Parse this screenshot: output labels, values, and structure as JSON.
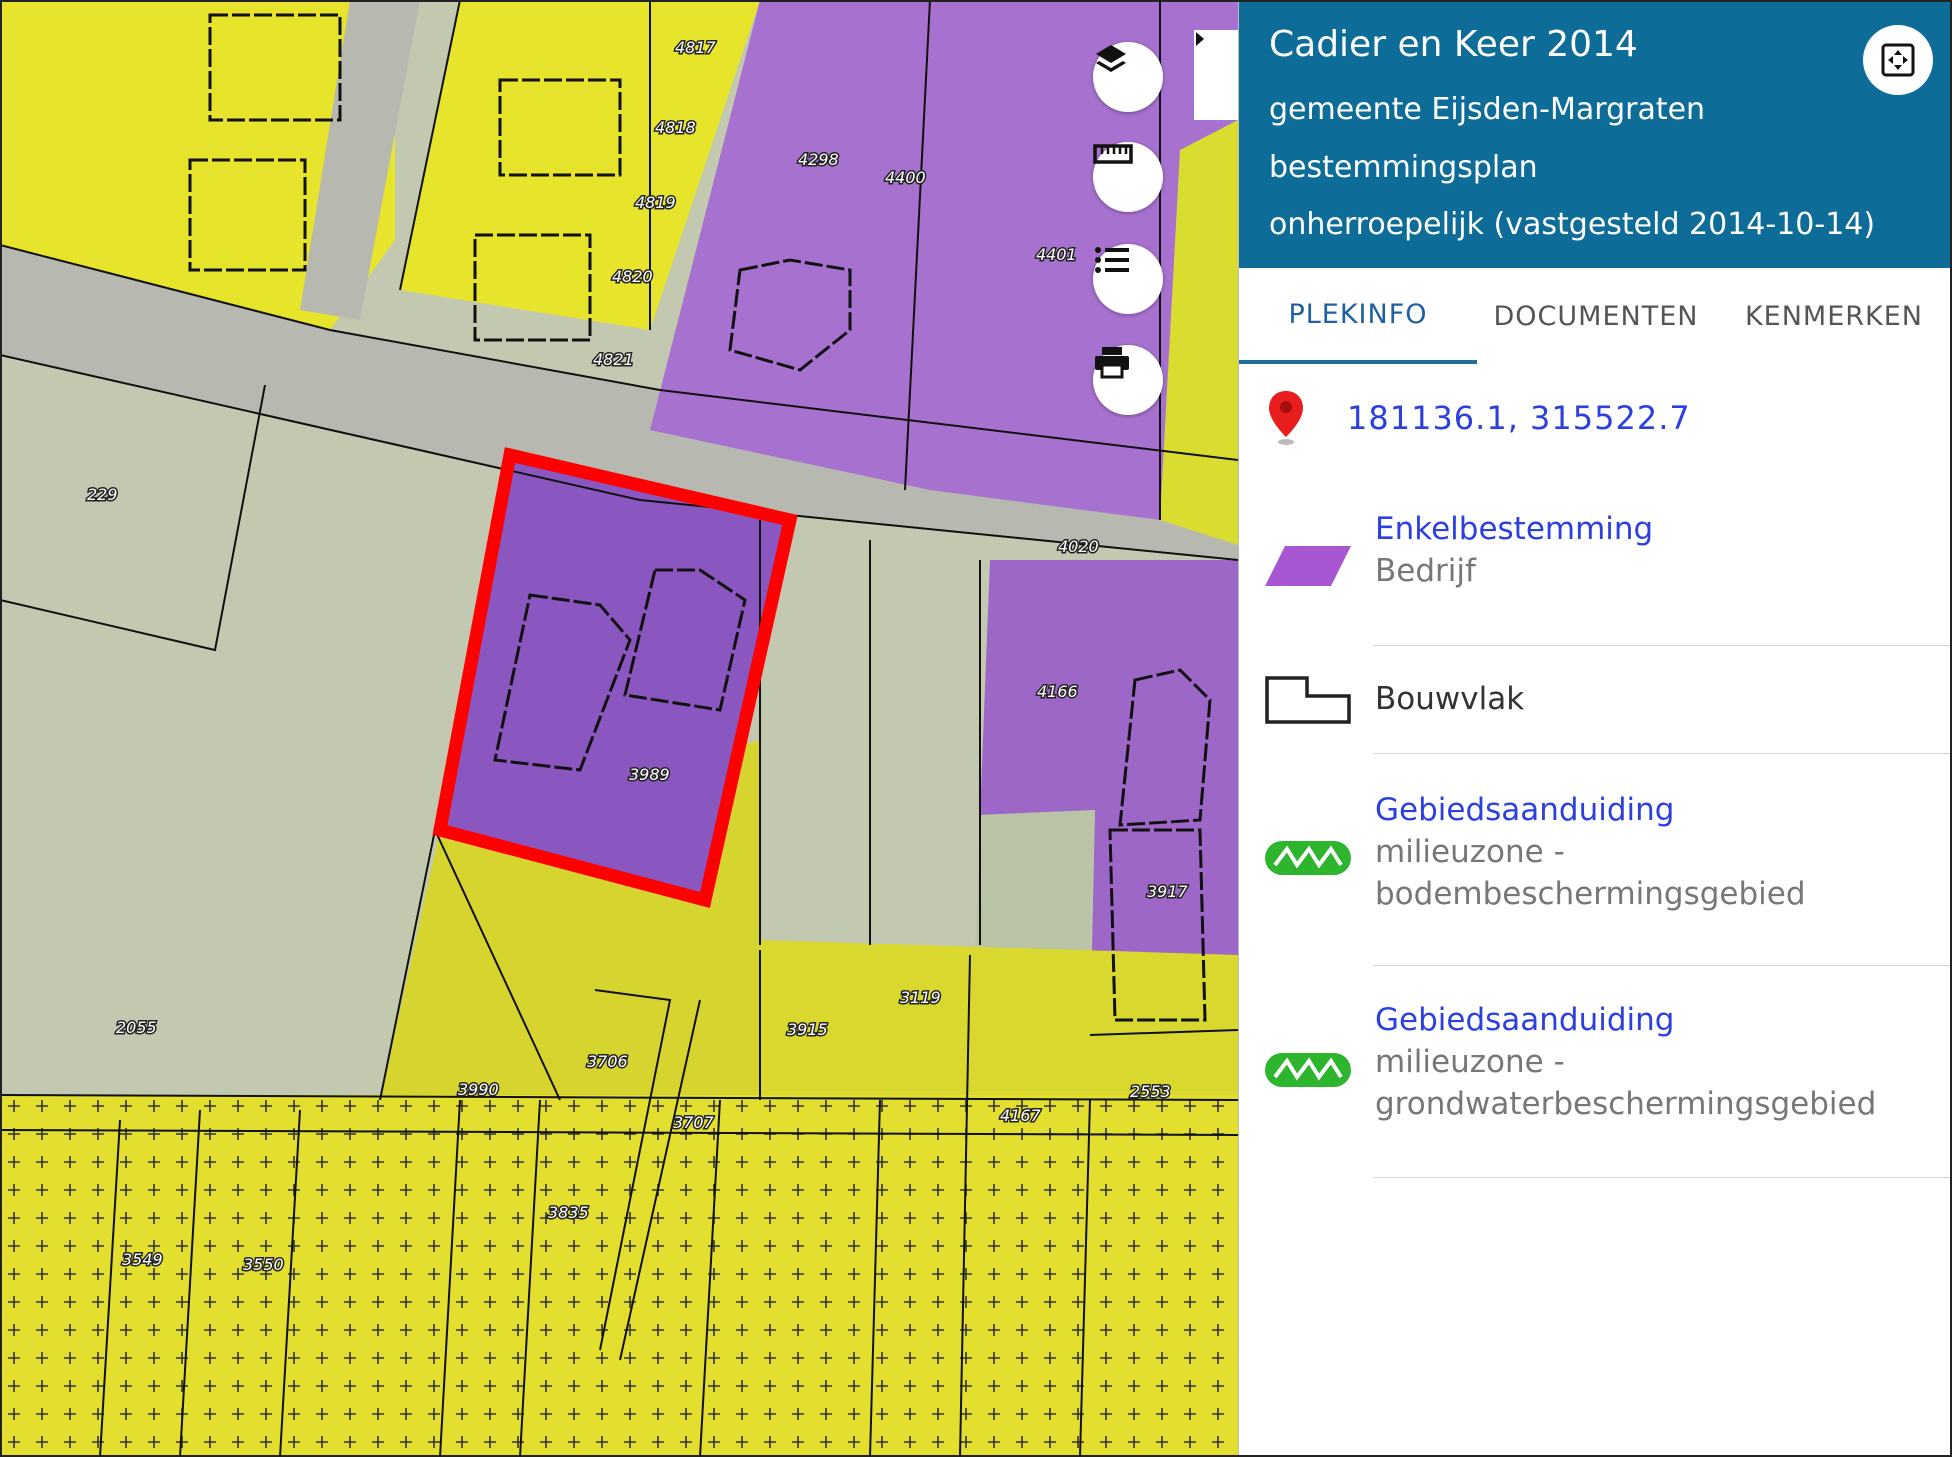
{
  "map": {
    "parcels": {
      "p4817": "4817",
      "p4818": "4818",
      "p4819": "4819",
      "p4820": "4820",
      "p4821": "4821",
      "p4298": "4298",
      "p4400": "4400",
      "p4401": "4401",
      "p229": "229",
      "p4020": "4020",
      "p3989": "3989",
      "p4166": "4166",
      "p3917": "3917",
      "p2055": "2055",
      "p3119": "3119",
      "p3915": "3915",
      "p3706": "3706",
      "p3990": "3990",
      "p2553": "2553",
      "p3707": "3707",
      "p4167": "4167",
      "p3835": "3835",
      "p3549": "3549",
      "p3550": "3550"
    },
    "controls": {
      "layers_icon": "layers-icon",
      "measure_icon": "ruler-icon",
      "legend_icon": "list-icon",
      "print_icon": "printer-icon",
      "collapse_icon": "caret-right-icon"
    },
    "colors": {
      "bedrijf": "#9b59c8",
      "wonen": "#e6e22e",
      "agrarisch": "#bfc9a8",
      "selection": "#ff0000"
    }
  },
  "panel": {
    "title": "Cadier en Keer 2014",
    "municipality": "gemeente Eijsden-Margraten",
    "plan_type": "bestemmingsplan",
    "status": "onherroepelijk (vastgesteld 2014-10-14)",
    "fullscreen_icon": "fullscreen-icon",
    "header_color": "#0d6c98",
    "tabs": [
      {
        "label": "PLEKINFO"
      },
      {
        "label": "DOCUMENTEN"
      },
      {
        "label": "KENMERKEN"
      }
    ],
    "coordinates": "181136.1, 315522.7",
    "location_icon": "location-pin-icon",
    "items": [
      {
        "title": "Enkelbestemming",
        "subtitle": "Bedrijf",
        "icon": "purple-parallelogram-icon"
      },
      {
        "title": "Bouwvlak",
        "icon": "bouwvlak-outline-icon"
      },
      {
        "title": "Gebiedsaanduiding",
        "subtitle_1": "milieuzone -",
        "subtitle_2": "bodembeschermingsgebied",
        "icon": "green-zigzag-icon"
      },
      {
        "title": "Gebiedsaanduiding",
        "subtitle_1": "milieuzone -",
        "subtitle_2": "grondwaterbeschermingsgebied",
        "icon": "green-zigzag-icon"
      }
    ]
  }
}
